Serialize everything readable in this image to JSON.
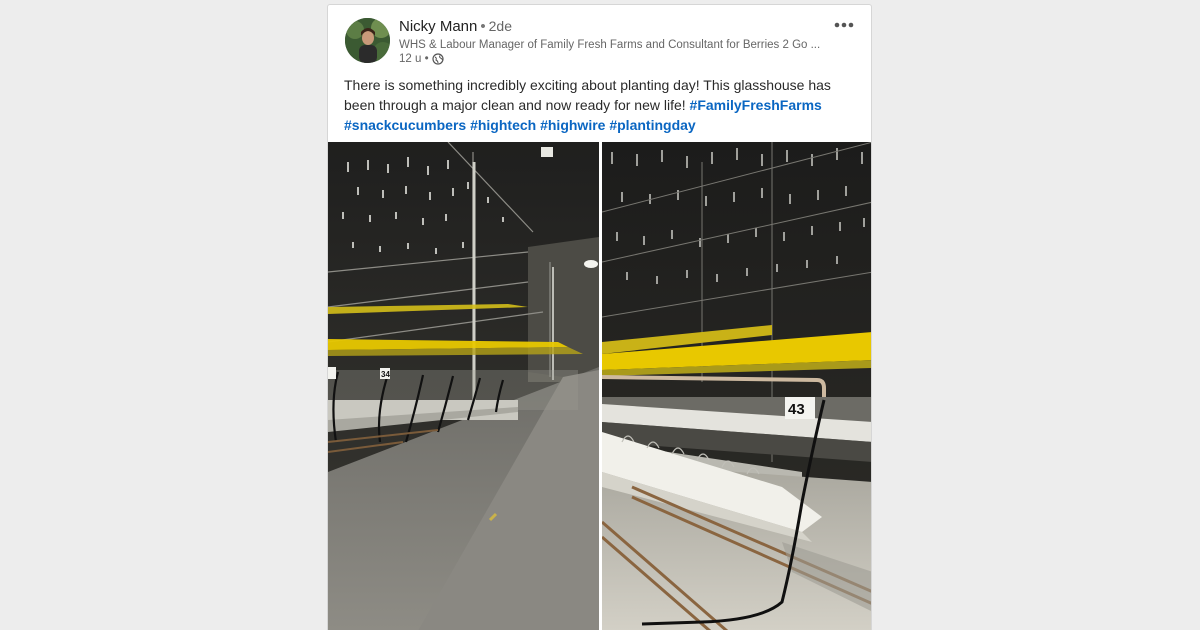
{
  "post": {
    "author_name": "Nicky Mann",
    "separator": "•",
    "degree": "2de",
    "headline": "WHS & Labour Manager of Family Fresh Farms and Consultant for Berries 2 Go ...",
    "time": "12 u •",
    "text_lines": [
      "There is something incredibly exciting about planting day! This glasshouse has been through a major clean and now ready for new life! "
    ],
    "hashtags": [
      "#FamilyFreshFarms",
      "#snackcucumbers",
      "#hightech",
      "#highwire",
      "#plantingday"
    ],
    "icons": {
      "avatar": "profile-photo",
      "more": "more-options-icon",
      "visibility": "globe-icon"
    }
  },
  "photos": [
    {
      "name": "glasshouse-aisle-photo",
      "sign_label": "34"
    },
    {
      "name": "glasshouse-row-photo",
      "sign_label": "43"
    }
  ],
  "colors": {
    "hashtag": "#0a66c2",
    "background": "#ededed",
    "yellow_wire": "#e8c800"
  }
}
